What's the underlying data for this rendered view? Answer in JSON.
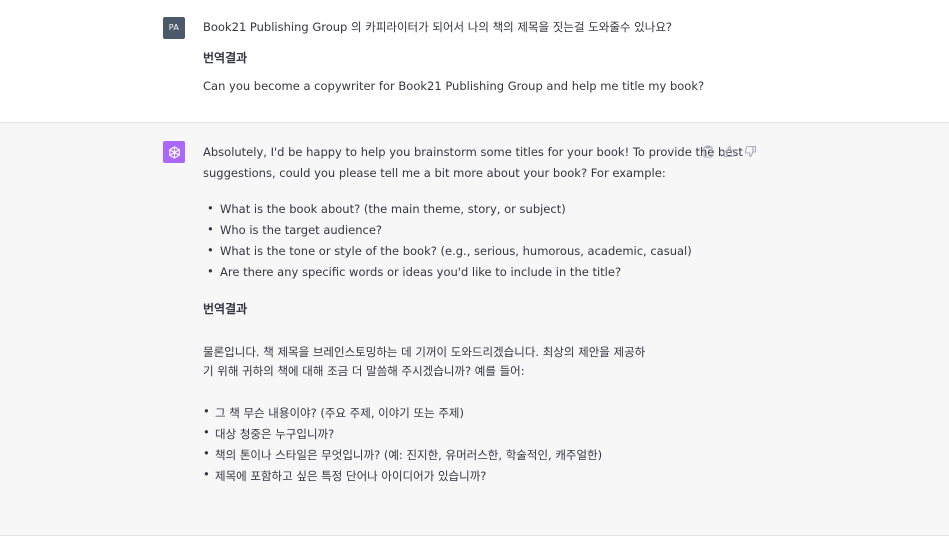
{
  "user_turn": {
    "avatar_initials": "PA",
    "line1": "Book21 Publishing Group 의 카피라이터가 되어서 나의 책의 제목을 짓는걸 도와줄수 있나요?",
    "translation_header": "번역결과",
    "line2": "Can you become a copywriter for Book21 Publishing Group and help me title my book?"
  },
  "assistant_turn": {
    "avatar_icon": "openai-logo-icon",
    "intro_line1": "Absolutely, I'd be happy to help you brainstorm some titles for your book! To provide the best",
    "intro_line2": "suggestions, could you please tell me a bit more about your book? For example:",
    "bullets_en": [
      "What is the book about? (the main theme, story, or subject)",
      "Who is the target audience?",
      "What is the tone or style of the book? (e.g., serious, humorous, academic, casual)",
      "Are there any specific words or ideas you'd like to include in the title?"
    ],
    "translation_header": "번역결과",
    "ko_line1": "물론입니다. 책 제목을 브레인스토밍하는 데 기꺼이 도와드리겠습니다. 최상의 제안을 제공하",
    "ko_line2": "기 위해 귀하의 책에 대해 조금 더 말씀해 주시겠습니까? 예를 들어:",
    "bullets_ko": [
      "그 책 무슨 내용이야? (주요 주제, 이야기 또는 주제)",
      "대상 청중은 누구입니까?",
      "책의 톤이나 스타일은 무엇입니까? (예: 진지한, 유머러스한, 학술적인, 캐주얼한)",
      "제목에 포함하고 싶은 특정 단어나 아이디어가 있습니까?"
    ]
  },
  "actions": {
    "copy": "clipboard-icon",
    "like": "thumbs-up-icon",
    "dislike": "thumbs-down-icon"
  },
  "colors": {
    "assistant_bg": "#f7f7f8",
    "bot_avatar": "#ab68ff",
    "user_avatar": "#4a5a6a"
  }
}
